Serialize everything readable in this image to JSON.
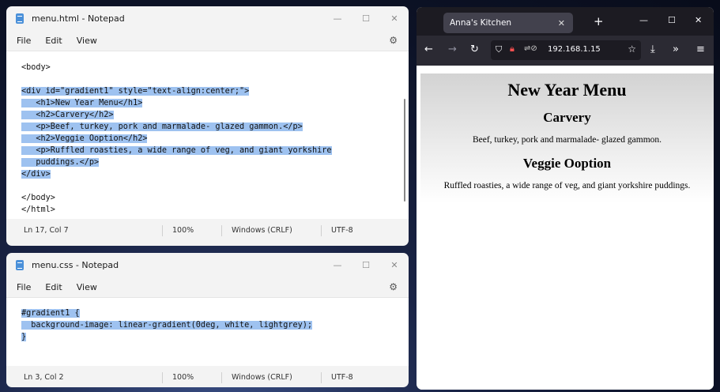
{
  "notepad_html": {
    "title": "menu.html - Notepad",
    "menu": [
      "File",
      "Edit",
      "View"
    ],
    "lines": [
      {
        "text": "<body>",
        "hl": false
      },
      {
        "text": "",
        "hl": false
      },
      {
        "text": "<div id=\"gradient1\" style=\"text-align:center;\">",
        "hl": true
      },
      {
        "text": "   <h1>New Year Menu</h1>",
        "hl": true
      },
      {
        "text": "   <h2>Carvery</h2>",
        "hl": true
      },
      {
        "text": "   <p>Beef, turkey, pork and marmalade- glazed gammon.</p>",
        "hl": true
      },
      {
        "text": "   <h2>Veggie Ooption</h2>",
        "hl": true
      },
      {
        "text": "   <p>Ruffled roasties, a wide range of veg, and giant yorkshire",
        "hl": true
      },
      {
        "text": "   puddings.</p>",
        "hl": true
      },
      {
        "text": "</div>",
        "hl": true
      },
      {
        "text": "",
        "hl": false
      },
      {
        "text": "</body>",
        "hl": false
      },
      {
        "text": "</html>",
        "hl": false
      }
    ],
    "status": {
      "position": "Ln 17, Col 7",
      "zoom": "100%",
      "line_ending": "Windows (CRLF)",
      "encoding": "UTF-8"
    }
  },
  "notepad_css": {
    "title": "menu.css - Notepad",
    "menu": [
      "File",
      "Edit",
      "View"
    ],
    "lines": [
      {
        "text": "#gradient1 {",
        "hl": true
      },
      {
        "text": "  background-image: linear-gradient(0deg, white, lightgrey);",
        "hl": true
      },
      {
        "text": "}",
        "hl": true
      }
    ],
    "status": {
      "position": "Ln 3, Col 2",
      "zoom": "100%",
      "line_ending": "Windows (CRLF)",
      "encoding": "UTF-8"
    }
  },
  "browser": {
    "tab_title": "Anna's Kitchen",
    "url": "192.168.1.15",
    "page": {
      "h1": "New Year Menu",
      "section1_title": "Carvery",
      "section1_text": "Beef, turkey, pork and marmalade- glazed gammon.",
      "section2_title": "Veggie Ooption",
      "section2_text": "Ruffled roasties, a wide range of veg, and giant yorkshire puddings."
    }
  },
  "icons": [
    "notepad-icon",
    "settings-gear-icon",
    "minimize-icon",
    "maximize-icon",
    "close-icon",
    "back-arrow-icon",
    "forward-arrow-icon",
    "reload-icon",
    "shield-icon",
    "lock-icon",
    "bookmark-star-icon",
    "download-icon",
    "overflow-chevron-icon",
    "hamburger-menu-icon",
    "new-tab-plus-icon"
  ]
}
